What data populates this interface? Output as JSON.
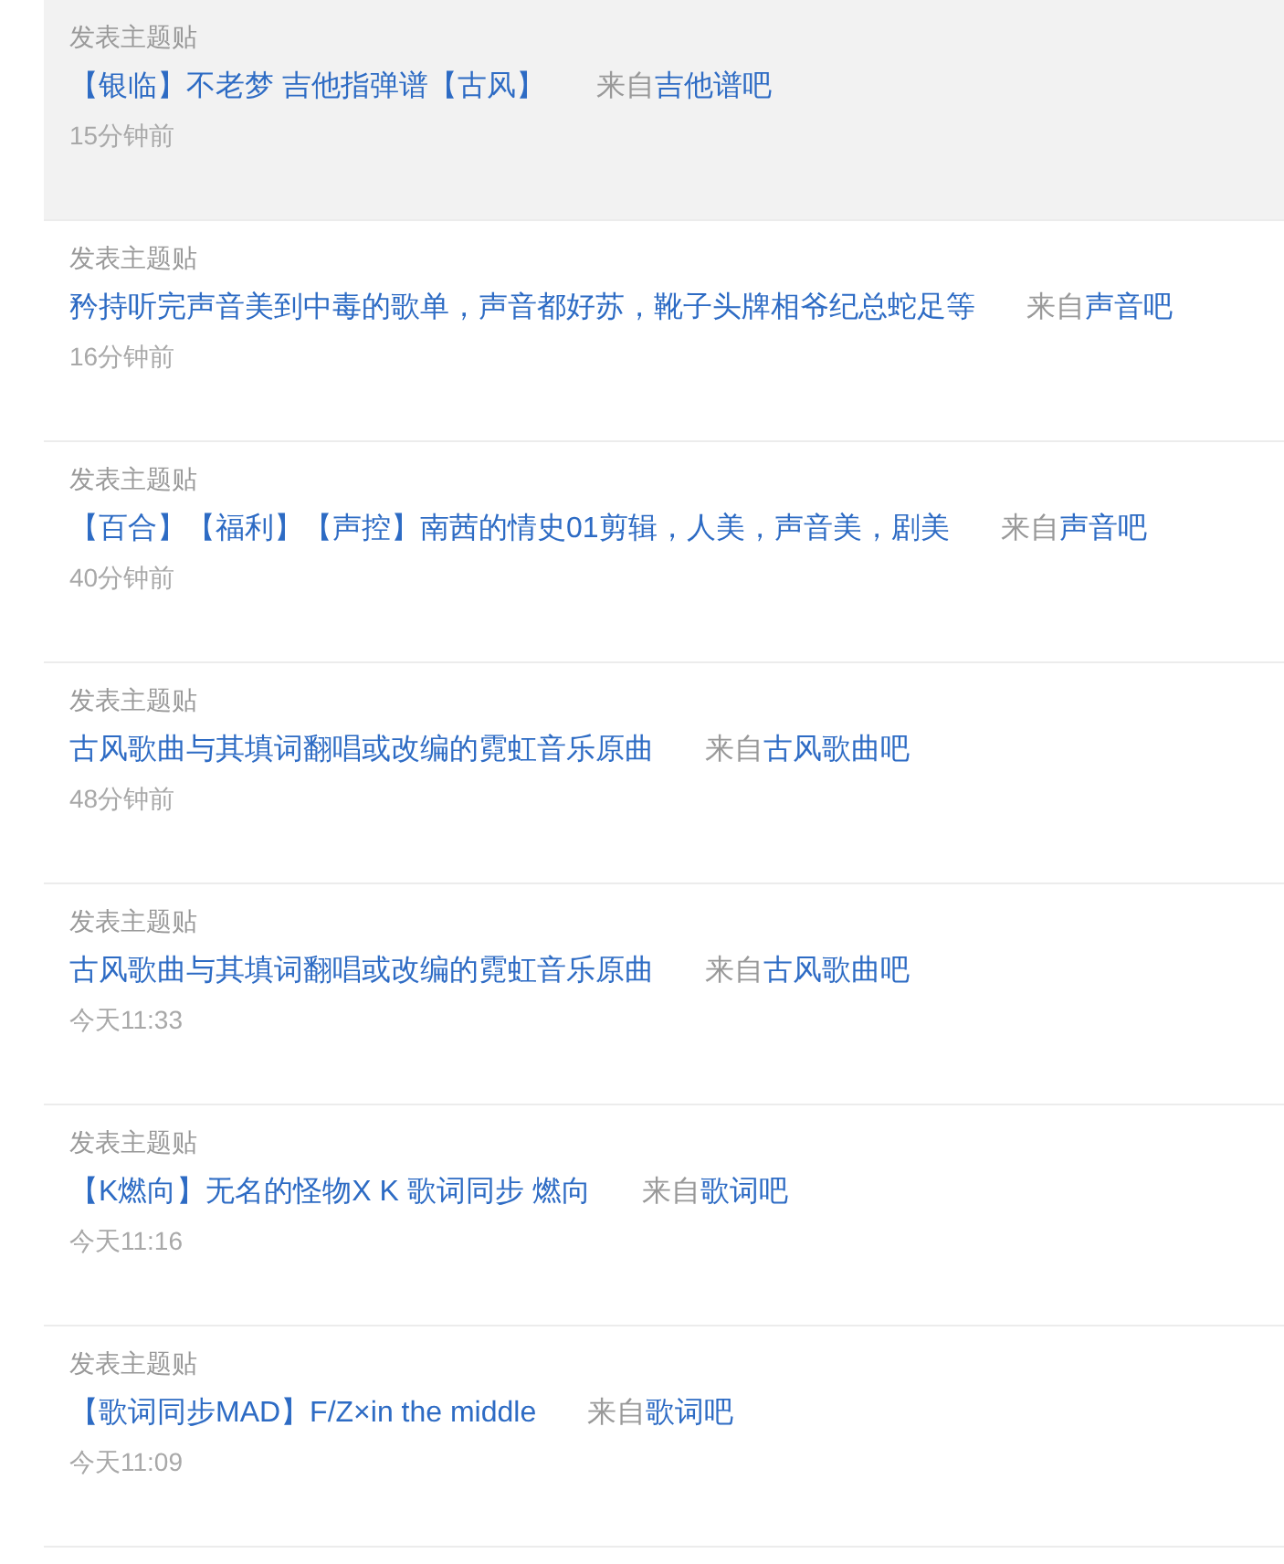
{
  "posts": [
    {
      "action": "发表主题贴",
      "title": "【银临】不老梦 吉他指弹谱【古风】",
      "from": "来自",
      "forum": "吉他谱吧",
      "time": "15分钟前",
      "selected": true
    },
    {
      "action": "发表主题贴",
      "title": "矜持听完声音美到中毒的歌单，声音都好苏，靴子头牌相爷纪总蛇足等",
      "from": "来自",
      "forum": "声音吧",
      "time": "16分钟前",
      "selected": false
    },
    {
      "action": "发表主题贴",
      "title": "【百合】【福利】【声控】南茜的情史01剪辑，人美，声音美，剧美",
      "from": "来自",
      "forum": "声音吧",
      "time": "40分钟前",
      "selected": false
    },
    {
      "action": "发表主题贴",
      "title": "古风歌曲与其填词翻唱或改编的霓虹音乐原曲",
      "from": "来自",
      "forum": "古风歌曲吧",
      "time": "48分钟前",
      "selected": false
    },
    {
      "action": "发表主题贴",
      "title": "古风歌曲与其填词翻唱或改编的霓虹音乐原曲",
      "from": "来自",
      "forum": "古风歌曲吧",
      "time": "今天11:33",
      "selected": false
    },
    {
      "action": "发表主题贴",
      "title": "【K燃向】无名的怪物X K 歌词同步 燃向",
      "from": "来自",
      "forum": "歌词吧",
      "time": "今天11:16",
      "selected": false
    },
    {
      "action": "发表主题贴",
      "title": "【歌词同步MAD】F/Z×in the middle",
      "from": "来自",
      "forum": "歌词吧",
      "time": "今天11:09",
      "selected": false
    }
  ]
}
